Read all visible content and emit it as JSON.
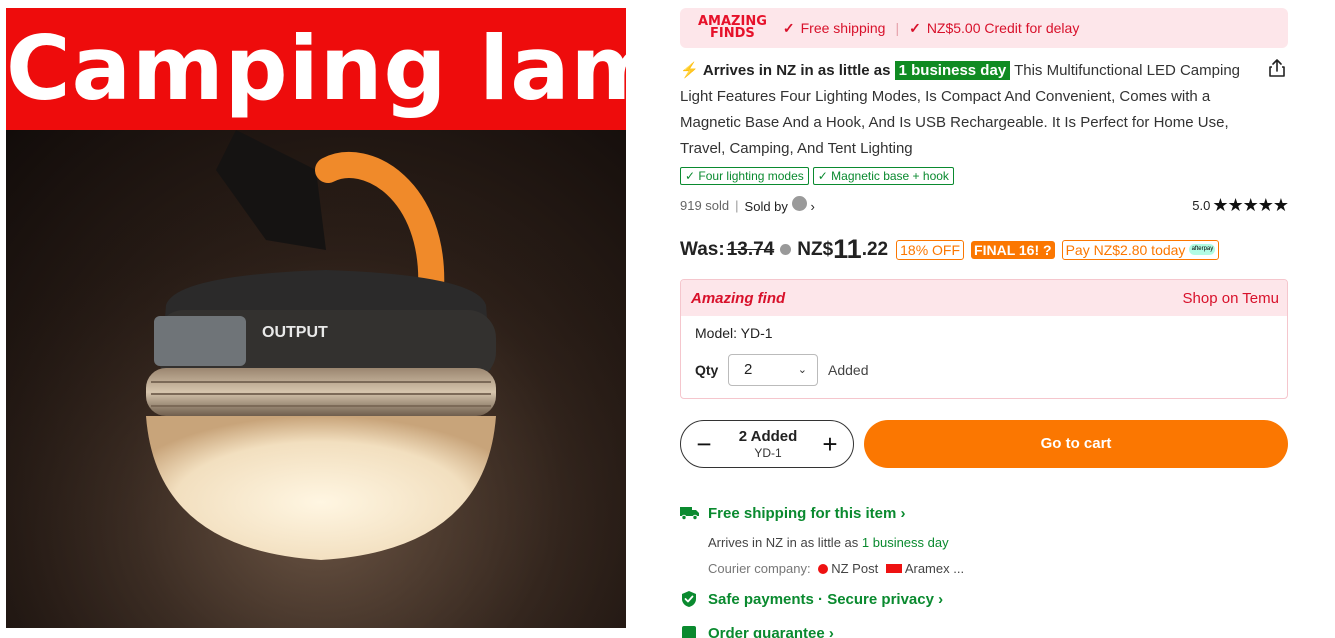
{
  "hero": {
    "banner_text": "Camping lamp",
    "lamp_label": "OUTPUT"
  },
  "banner": {
    "logo_line1": "AMAZING",
    "logo_line2": "FINDS",
    "free_shipping": "Free shipping",
    "credit": "NZ$5.00 Credit for delay"
  },
  "product": {
    "arrives_prefix": "Arrives in NZ in as little as",
    "arrives_highlight": "1 business day",
    "title": "This Multifunctional LED Camping Light Features Four Lighting Modes, Is Compact And Convenient, Comes with a Magnetic Base And a Hook, And Is USB Rechargeable. It Is Perfect for Home Use, Travel, Camping, And Tent Lighting",
    "tags": [
      "Four lighting modes",
      "Magnetic base + hook"
    ],
    "sold": "919 sold",
    "sold_by": "Sold by",
    "rating": "5.0",
    "stars": "★★★★★"
  },
  "price": {
    "was_label": "Was:",
    "was_value": "13.74",
    "currency": "NZ$",
    "whole": "11",
    "cents": ".22",
    "off": "18% OFF",
    "final": "FINAL 16!",
    "pay_today": "Pay NZ$2.80 today",
    "afterpay_label": "afterpay"
  },
  "selection": {
    "title": "Amazing find",
    "shop": "Shop on Temu",
    "model": "Model: YD-1",
    "qty_label": "Qty",
    "qty_value": "2",
    "added": "Added"
  },
  "cart": {
    "minus": "−",
    "plus": "+",
    "added_main": "2 Added",
    "added_sub": "YD-1",
    "go_cart": "Go to cart"
  },
  "shipping": {
    "head": "Free shipping for this item",
    "arrives_prefix": "Arrives in NZ in as little as",
    "arrives_highlight": "1 business day",
    "courier_label": "Courier company:",
    "courier1": "NZ Post",
    "courier2": "Aramex",
    "more": "...",
    "payments": "Safe payments · Secure privacy",
    "order": "Order guarantee"
  },
  "colors": {
    "accent": "#fb7701",
    "green": "#0a8a2f",
    "red": "#d8112b"
  }
}
